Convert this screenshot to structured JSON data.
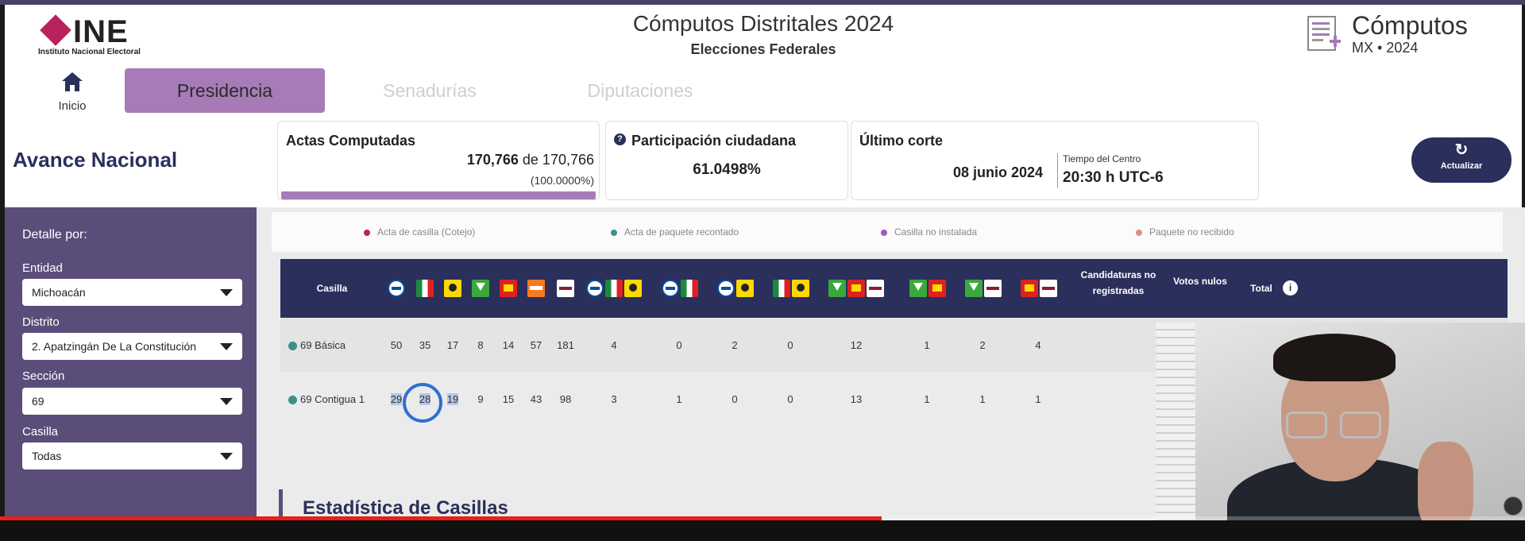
{
  "header": {
    "logo_text": "INE",
    "logo_subtext": "Instituto Nacional Electoral",
    "title": "Cómputos Distritales 2024",
    "subtitle": "Elecciones Federales",
    "brand_title": "Cómputos",
    "brand_subtitle": "MX • 2024"
  },
  "nav": {
    "home_label": "Inicio",
    "tabs": [
      {
        "label": "Presidencia",
        "active": true
      },
      {
        "label": "Senadurías",
        "active": false
      },
      {
        "label": "Diputaciones",
        "active": false
      }
    ]
  },
  "summary": {
    "section_title": "Avance Nacional",
    "actas": {
      "title": "Actas Computadas",
      "count": "170,766",
      "of_text": "de 170,766",
      "percent": "(100.0000%)",
      "progress_fraction": 1.0
    },
    "participacion": {
      "title": "Participación ciudadana",
      "value": "61.0498%"
    },
    "corte": {
      "title": "Último corte",
      "date": "08 junio 2024",
      "tz_label": "Tiempo del Centro",
      "time": "20:30 h UTC-6"
    },
    "refresh_label": "Actualizar"
  },
  "filters": {
    "title": "Detalle por:",
    "fields": [
      {
        "label": "Entidad",
        "value": "Michoacán"
      },
      {
        "label": "Distrito",
        "value": "2. Apatzingán De La Constitución"
      },
      {
        "label": "Sección",
        "value": "69"
      },
      {
        "label": "Casilla",
        "value": "Todas"
      }
    ]
  },
  "legend": [
    {
      "label": "Acta de casilla (Cotejo)",
      "color": "#b8235e"
    },
    {
      "label": "Acta de paquete recontado",
      "color": "#3d8f8a"
    },
    {
      "label": "Casilla no instalada",
      "color": "#a05bbf"
    },
    {
      "label": "Paquete no recibido",
      "color": "#e08a8a"
    }
  ],
  "table": {
    "headers": {
      "casilla": "Casilla",
      "no_registradas": "Candidaturas no registradas",
      "nulos": "Votos nulos",
      "total": "Total",
      "info_icon": "i"
    },
    "party_logo_labels": {
      "pan": "PAN",
      "pri": "PRI",
      "prd": "PRD",
      "verde": "VERDE",
      "pt": "PT",
      "mc": "MC",
      "morena": "morena"
    },
    "rows": [
      {
        "casilla": "69 Básica",
        "values": [
          "50",
          "35",
          "17",
          "8",
          "14",
          "57",
          "181",
          "4",
          "0",
          "2",
          "0",
          "12",
          "1",
          "2",
          "4"
        ]
      },
      {
        "casilla": "69 Contigua 1",
        "values": [
          "29",
          "28",
          "19",
          "9",
          "15",
          "43",
          "98",
          "3",
          "1",
          "0",
          "0",
          "13",
          "1",
          "1",
          "1"
        ]
      }
    ]
  },
  "stats_title": "Estadística de Casillas",
  "video": {
    "progress_fraction": 0.578
  },
  "colors": {
    "brand_navy": "#2b2f5c",
    "brand_purple": "#a67bb7",
    "sidebar": "#5a4d7a",
    "video_red": "#e62117"
  }
}
